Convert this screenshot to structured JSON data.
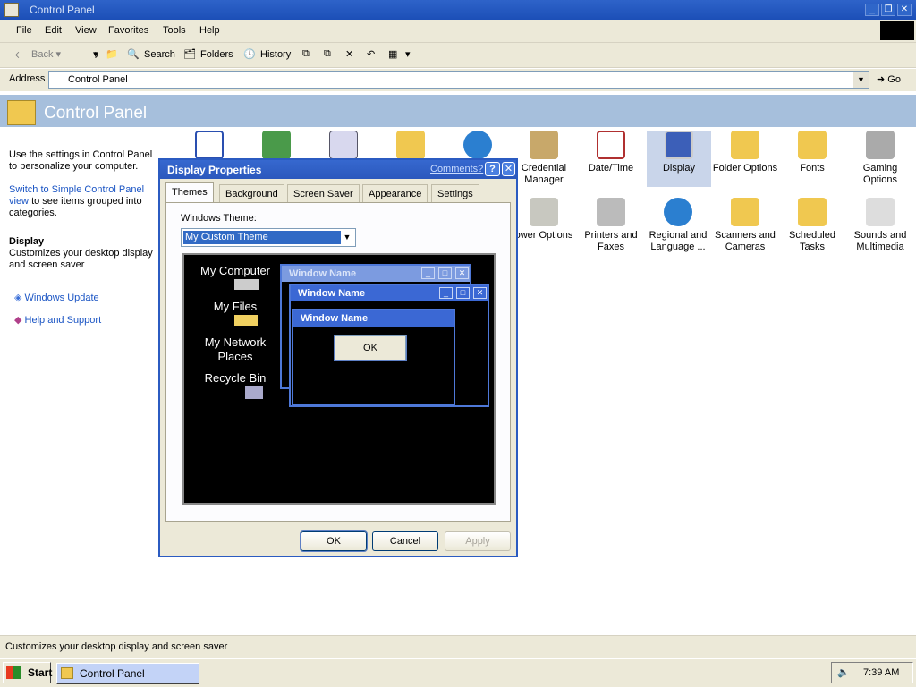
{
  "window": {
    "title": "Control Panel"
  },
  "menu": [
    "File",
    "Edit",
    "View",
    "Favorites",
    "Tools",
    "Help"
  ],
  "toolbar": {
    "back": "Back",
    "search": "Search",
    "folders": "Folders",
    "history": "History"
  },
  "address": {
    "label": "Address",
    "value": "Control Panel",
    "go": "Go"
  },
  "header": {
    "title": "Control Panel"
  },
  "left_pane": {
    "intro": "Use the settings in Control Panel to personalize your computer.",
    "switch_link": "Switch to Simple Control Panel view",
    "switch_rest": "to see items grouped into categories.",
    "selected_title": "Display",
    "selected_desc": "Customizes your desktop display and screen saver",
    "links": [
      "Windows Update",
      "Help and Support"
    ]
  },
  "icons": {
    "row1": [
      "Credential Manager",
      "Date/Time",
      "Display",
      "Folder Options",
      "Fonts",
      "Gaming Options"
    ],
    "row2": [
      "ower Options",
      "Printers and Faxes",
      "Regional and Language ...",
      "Scanners and Cameras",
      "Scheduled Tasks",
      "Sounds and Multimedia"
    ]
  },
  "dialog": {
    "title": "Display Properties",
    "comments": "Comments?",
    "help": "?",
    "tabs": [
      "Themes",
      "Background",
      "Screen Saver",
      "Appearance",
      "Settings"
    ],
    "theme_label": "Windows Theme:",
    "theme_value": "My Custom Theme",
    "preview": {
      "desktop_icons": [
        "My Computer",
        "My Files",
        "My Network Places",
        "Recycle Bin"
      ],
      "window_title": "Window Name",
      "ok": "OK"
    },
    "buttons": {
      "ok": "OK",
      "cancel": "Cancel",
      "apply": "Apply"
    }
  },
  "statusbar": {
    "text": "Customizes your desktop display and screen saver"
  },
  "taskbar": {
    "start": "Start",
    "item": "Control Panel",
    "clock": "7:39 AM"
  },
  "colors": {
    "titlebar": "#1c4fb7",
    "header": "#a6bfdc",
    "link": "#1b55c4",
    "selection": "#316ac5"
  }
}
